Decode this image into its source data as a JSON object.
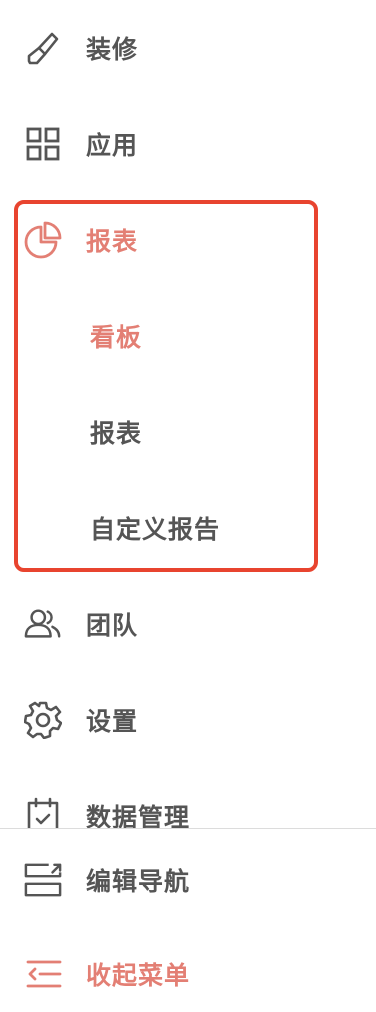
{
  "menu": {
    "items": [
      {
        "label": "装修",
        "icon": "brush-icon"
      },
      {
        "label": "应用",
        "icon": "grid-icon"
      },
      {
        "label": "报表",
        "icon": "pie-chart-icon",
        "active": true,
        "children": [
          {
            "label": "看板",
            "active": true
          },
          {
            "label": "报表"
          },
          {
            "label": "自定义报告"
          }
        ]
      },
      {
        "label": "团队",
        "icon": "team-icon"
      },
      {
        "label": "设置",
        "icon": "gear-icon"
      },
      {
        "label": "数据管理",
        "icon": "calendar-check-icon"
      }
    ]
  },
  "footer": {
    "edit_nav_label": "编辑导航",
    "edit_nav_icon": "edit-nav-icon",
    "collapse_label": "收起菜单",
    "collapse_icon": "collapse-menu-icon"
  },
  "colors": {
    "accent": "#e37f74",
    "text": "#555555",
    "highlight_border": "#e8442f",
    "divider": "#dcdcdc"
  }
}
